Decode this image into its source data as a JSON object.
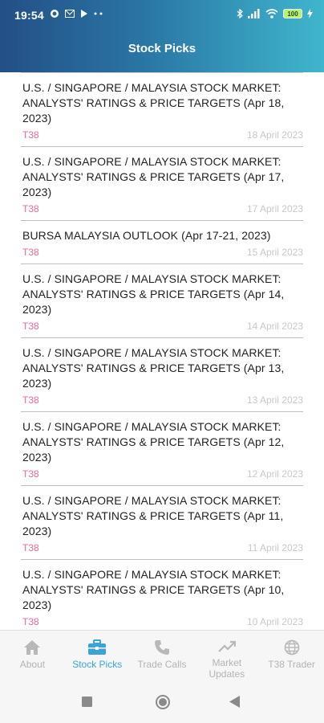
{
  "status_bar": {
    "time": "19:54",
    "battery": "100",
    "icons": [
      "whatsapp-icon",
      "mail-icon",
      "play-icon",
      "more-dots-icon",
      "bluetooth-icon",
      "signal-icon",
      "wifi-icon",
      "battery-icon",
      "charging-icon"
    ]
  },
  "header": {
    "title": "Stock Picks"
  },
  "articles": [
    {
      "title": "U.S. / SINGAPORE / MALAYSIA STOCK MARKET: ANALYSTS' RATINGS & PRICE TARGETS (Apr 18, 2023)",
      "source": "T38",
      "date": "18 April 2023"
    },
    {
      "title": "U.S. / SINGAPORE / MALAYSIA STOCK MARKET: ANALYSTS' RATINGS & PRICE TARGETS (Apr 17, 2023)",
      "source": "T38",
      "date": "17 April 2023"
    },
    {
      "title": "BURSA MALAYSIA OUTLOOK (Apr 17-21, 2023)",
      "source": "T38",
      "date": "15 April 2023"
    },
    {
      "title": "U.S. / SINGAPORE / MALAYSIA STOCK MARKET: ANALYSTS' RATINGS & PRICE TARGETS (Apr 14, 2023)",
      "source": "T38",
      "date": "14 April 2023"
    },
    {
      "title": "U.S. / SINGAPORE / MALAYSIA STOCK MARKET: ANALYSTS' RATINGS & PRICE TARGETS (Apr 13, 2023)",
      "source": "T38",
      "date": "13 April 2023"
    },
    {
      "title": "U.S. / SINGAPORE / MALAYSIA STOCK MARKET: ANALYSTS' RATINGS & PRICE TARGETS (Apr 12, 2023)",
      "source": "T38",
      "date": "12 April 2023"
    },
    {
      "title": "U.S. / SINGAPORE / MALAYSIA STOCK MARKET: ANALYSTS' RATINGS & PRICE TARGETS (Apr 11, 2023)",
      "source": "T38",
      "date": "11 April 2023"
    },
    {
      "title": "U.S. / SINGAPORE / MALAYSIA STOCK MARKET: ANALYSTS' RATINGS & PRICE TARGETS (Apr 10, 2023)",
      "source": "T38",
      "date": "10 April 2023"
    }
  ],
  "bottom_nav": [
    {
      "label": "About",
      "icon": "home-icon",
      "active": false
    },
    {
      "label": "Stock Picks",
      "icon": "briefcase-icon",
      "active": true
    },
    {
      "label": "Trade Calls",
      "icon": "phone-icon",
      "active": false
    },
    {
      "label": "Market Updates",
      "icon": "trending-up-icon",
      "active": false
    },
    {
      "label": "T38 Trader",
      "icon": "globe-icon",
      "active": false
    }
  ],
  "system_nav": {
    "icons": [
      "recents-square-icon",
      "home-circle-icon",
      "back-triangle-icon"
    ]
  },
  "colors": {
    "header_start": "#234f86",
    "header_end": "#3fb6cc",
    "accent_active": "#3aa3d9",
    "source_pink": "#e86aa1",
    "date_grey": "#c8c8c8"
  }
}
